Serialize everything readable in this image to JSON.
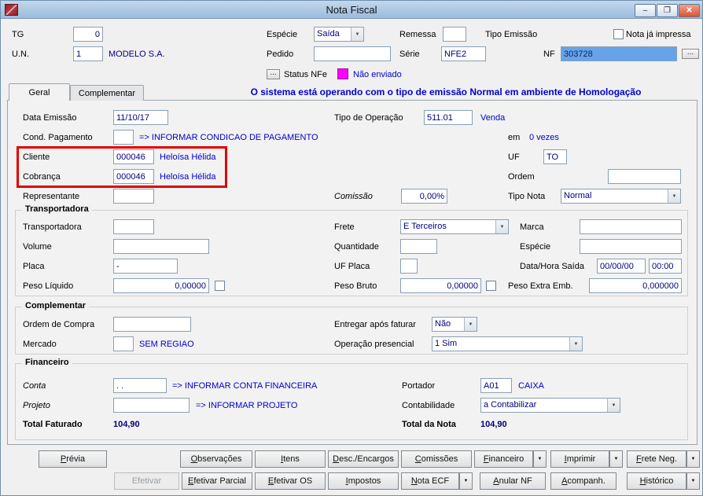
{
  "window": {
    "title": "Nota Fiscal"
  },
  "glyphs": {
    "minimize": "–",
    "maximize": "❐",
    "close": "✕",
    "combo_arrow": "▼",
    "dots": "..."
  },
  "colors": {
    "value_text": "#000080",
    "hint_text": "#0000cd",
    "banner_text": "#0000cd",
    "status_nfe_swatch": "#ff00ff",
    "highlight_box": "#e00000",
    "nf_selection_bg": "#66a3e8"
  },
  "header": {
    "tg_label": "TG",
    "tg_value": "0",
    "un_label": "U.N.",
    "un_value": "1",
    "company": "MODELO S.A.",
    "especie_label": "Espécie",
    "especie_value": "Saída",
    "pedido_label": "Pedido",
    "pedido_value": "",
    "remessa_label": "Remessa",
    "remessa_value": "",
    "serie_label": "Série",
    "serie_value": "NFE2",
    "tipo_emissao_label": "Tipo Emissão",
    "nota_impressa_label": "Nota já impressa",
    "nf_label": "NF",
    "nf_value": "303728",
    "status_label": "Status NFe",
    "status_value": "Não enviado"
  },
  "tabs": {
    "geral": "Geral",
    "complementar": "Complementar"
  },
  "banner": "O sistema está operando com o tipo de emissão Normal em ambiente de Homologação",
  "geral": {
    "data_emissao_label": "Data Emissão",
    "data_emissao_value": "11/10/17",
    "tipo_operacao_label": "Tipo de Operação",
    "tipo_operacao_value": "511.01",
    "tipo_operacao_desc": "Venda",
    "cond_pagamento_label": "Cond. Pagamento",
    "cond_pagamento_value": "",
    "cond_pagamento_hint": "=> INFORMAR CONDICAO DE PAGAMENTO",
    "parcelas_prefix": "em",
    "parcelas_value": "0 vezes",
    "cliente_label": "Cliente",
    "cliente_value": "000046",
    "cliente_name": "Heloísa Hélida",
    "cobranca_label": "Cobrança",
    "cobranca_value": "000046",
    "cobranca_name": "Heloísa Hélida",
    "uf_label": "UF",
    "uf_value": "TO",
    "ordem_label": "Ordem",
    "ordem_value": "",
    "representante_label": "Representante",
    "representante_value": "",
    "comissao_label": "Comissão",
    "comissao_value": "0,00%",
    "tipo_nota_label": "Tipo Nota",
    "tipo_nota_value": "Normal"
  },
  "transportadora": {
    "title": "Transportadora",
    "transportadora_label": "Transportadora",
    "transportadora_value": "",
    "frete_label": "Frete",
    "frete_value": "E Terceiros",
    "marca_label": "Marca",
    "marca_value": "",
    "volume_label": "Volume",
    "volume_value": "",
    "quantidade_label": "Quantidade",
    "quantidade_value": "",
    "especie_label": "Espécie",
    "especie_value": "",
    "placa_label": "Placa",
    "placa_value": "-",
    "uf_placa_label": "UF Placa",
    "uf_placa_value": "",
    "data_hora_saida_label": "Data/Hora Saída",
    "data_saida_value": "00/00/00",
    "hora_saida_value": "00:00",
    "peso_liquido_label": "Peso Líquido",
    "peso_liquido_value": "0,00000",
    "peso_bruto_label": "Peso Bruto",
    "peso_bruto_value": "0,00000",
    "peso_extra_label": "Peso Extra Emb.",
    "peso_extra_value": "0,000000"
  },
  "complementar": {
    "title": "Complementar",
    "ordem_compra_label": "Ordem de Compra",
    "ordem_compra_value": "",
    "entregar_label": "Entregar após faturar",
    "entregar_value": "Não",
    "mercado_label": "Mercado",
    "mercado_value": "",
    "mercado_desc": "SEM REGIAO",
    "operacao_label": "Operação presencial",
    "operacao_value": "1 Sim"
  },
  "financeiro": {
    "title": "Financeiro",
    "conta_label": "Conta",
    "conta_value": ". .",
    "conta_hint": "=> INFORMAR CONTA FINANCEIRA",
    "portador_label": "Portador",
    "portador_value": "A01",
    "portador_desc": "CAIXA",
    "projeto_label": "Projeto",
    "projeto_value": "",
    "projeto_hint": "=> INFORMAR PROJETO",
    "contabilidade_label": "Contabilidade",
    "contabilidade_value": "a Contabilizar",
    "total_faturado_label": "Total Faturado",
    "total_faturado_value": "104,90",
    "total_nota_label": "Total da Nota",
    "total_nota_value": "104,90"
  },
  "buttons": {
    "previa": "Prévia",
    "observacoes": "Observações",
    "itens": "Itens",
    "desc_encargos": "Desc./Encargos",
    "comissoes": "Comissões",
    "financeiro": "Financeiro",
    "imprimir": "Imprimir",
    "frete_neg": "Frete Neg.",
    "efetivar": "Efetivar",
    "efetivar_parcial": "Efetivar Parcial",
    "efetivar_os": "Efetivar OS",
    "impostos": "Impostos",
    "nota_ecf": "Nota ECF",
    "anular_nf": "Anular NF",
    "acompanh": "Acompanh.",
    "historico": "Histórico"
  }
}
